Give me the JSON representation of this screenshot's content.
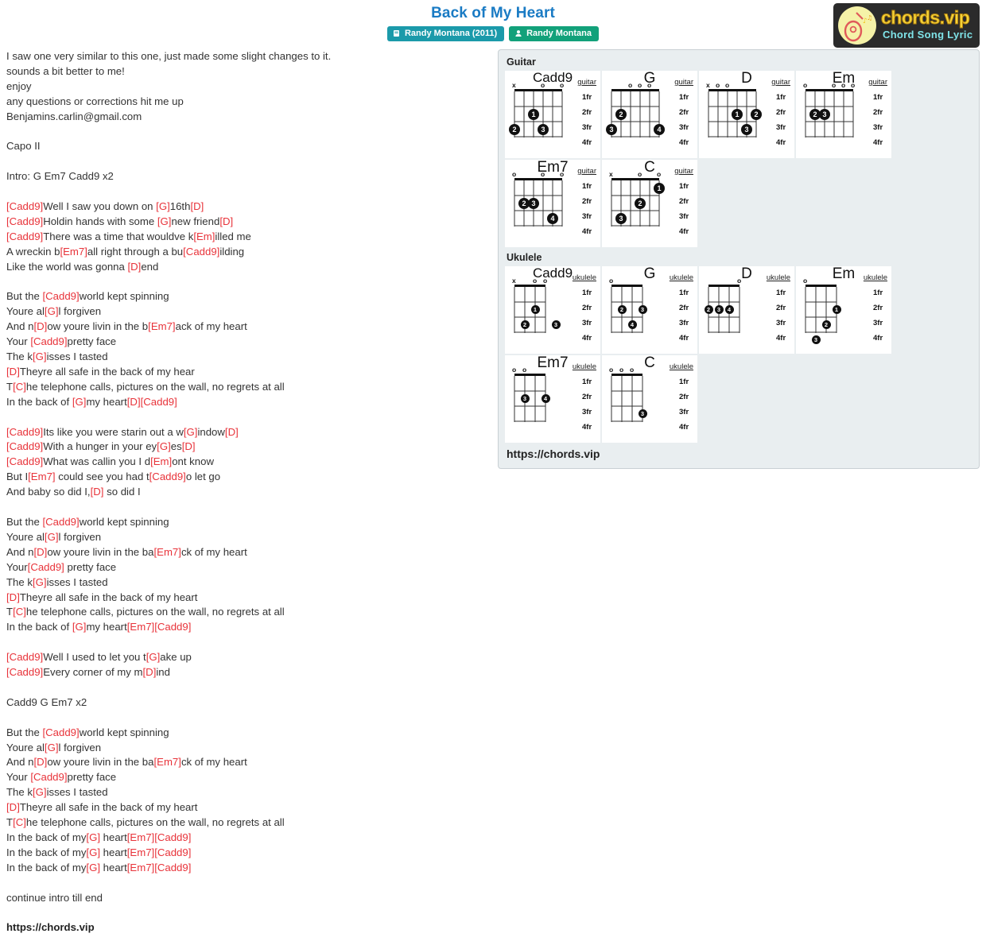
{
  "header": {
    "title": "Back of My Heart",
    "album_badge": "Randy Montana (2011)",
    "artist_badge": "Randy Montana",
    "logo_main": "chords.vip",
    "logo_sub": "Chord Song Lyric"
  },
  "sections": {
    "guitar_label": "Guitar",
    "ukulele_label": "Ukulele",
    "site_url": "https://chords.vip",
    "footer_url": "https://chords.vip"
  },
  "lyrics_lines": [
    {
      "t": "I saw one very similar to this one, just made some slight changes to it."
    },
    {
      "t": "sounds a bit better to me!"
    },
    {
      "t": "enjoy"
    },
    {
      "t": "any questions or corrections hit me up"
    },
    {
      "t": "Benjamins.carlin@gmail.com"
    },
    {
      "t": ""
    },
    {
      "t": "Capo II"
    },
    {
      "t": ""
    },
    {
      "t": "Intro: G Em7 Cadd9 x2"
    },
    {
      "t": ""
    },
    {
      "p": [
        [
          "c",
          "[Cadd9]"
        ],
        [
          "n",
          "Well I saw you down on "
        ],
        [
          "c",
          "[G]"
        ],
        [
          "n",
          "16th"
        ],
        [
          "c",
          "[D]"
        ]
      ]
    },
    {
      "p": [
        [
          "c",
          "[Cadd9]"
        ],
        [
          "n",
          "Holdin hands with some "
        ],
        [
          "c",
          "[G]"
        ],
        [
          "n",
          "new friend"
        ],
        [
          "c",
          "[D]"
        ]
      ]
    },
    {
      "p": [
        [
          "c",
          "[Cadd9]"
        ],
        [
          "n",
          "There was a time that wouldve k"
        ],
        [
          "c",
          "[Em]"
        ],
        [
          "n",
          "illed me"
        ]
      ]
    },
    {
      "p": [
        [
          "n",
          "A wreckin b"
        ],
        [
          "c",
          "[Em7]"
        ],
        [
          "n",
          "all right through a bu"
        ],
        [
          "c",
          "[Cadd9]"
        ],
        [
          "n",
          "ilding"
        ]
      ]
    },
    {
      "p": [
        [
          "n",
          "Like the world was gonna "
        ],
        [
          "c",
          "[D]"
        ],
        [
          "n",
          "end"
        ]
      ]
    },
    {
      "t": ""
    },
    {
      "p": [
        [
          "n",
          "But the "
        ],
        [
          "c",
          "[Cadd9]"
        ],
        [
          "n",
          "world kept spinning"
        ]
      ]
    },
    {
      "p": [
        [
          "n",
          "Youre al"
        ],
        [
          "c",
          "[G]"
        ],
        [
          "n",
          "l forgiven"
        ]
      ]
    },
    {
      "p": [
        [
          "n",
          "And n"
        ],
        [
          "c",
          "[D]"
        ],
        [
          "n",
          "ow youre livin in the b"
        ],
        [
          "c",
          "[Em7]"
        ],
        [
          "n",
          "ack of my heart"
        ]
      ]
    },
    {
      "p": [
        [
          "n",
          "Your "
        ],
        [
          "c",
          "[Cadd9]"
        ],
        [
          "n",
          "pretty face"
        ]
      ]
    },
    {
      "p": [
        [
          "n",
          "The k"
        ],
        [
          "c",
          "[G]"
        ],
        [
          "n",
          "isses I tasted"
        ]
      ]
    },
    {
      "p": [
        [
          "c",
          "[D]"
        ],
        [
          "n",
          "Theyre all safe in the back of my hear"
        ]
      ]
    },
    {
      "p": [
        [
          "n",
          "T"
        ],
        [
          "c",
          "[C]"
        ],
        [
          "n",
          "he telephone calls, pictures on the wall, no regrets at all"
        ]
      ]
    },
    {
      "p": [
        [
          "n",
          "In the back of "
        ],
        [
          "c",
          "[G]"
        ],
        [
          "n",
          "my heart"
        ],
        [
          "c",
          "[D][Cadd9]"
        ]
      ]
    },
    {
      "t": ""
    },
    {
      "p": [
        [
          "c",
          "[Cadd9]"
        ],
        [
          "n",
          "Its like you were starin out a w"
        ],
        [
          "c",
          "[G]"
        ],
        [
          "n",
          "indow"
        ],
        [
          "c",
          "[D]"
        ]
      ]
    },
    {
      "p": [
        [
          "c",
          "[Cadd9]"
        ],
        [
          "n",
          "With a hunger in your ey"
        ],
        [
          "c",
          "[G]"
        ],
        [
          "n",
          "es"
        ],
        [
          "c",
          "[D]"
        ]
      ]
    },
    {
      "p": [
        [
          "c",
          "[Cadd9]"
        ],
        [
          "n",
          "What was callin you I d"
        ],
        [
          "c",
          "[Em]"
        ],
        [
          "n",
          "ont know"
        ]
      ]
    },
    {
      "p": [
        [
          "n",
          "But I"
        ],
        [
          "c",
          "[Em7]"
        ],
        [
          "n",
          " could see you had t"
        ],
        [
          "c",
          "[Cadd9]"
        ],
        [
          "n",
          "o let go"
        ]
      ]
    },
    {
      "p": [
        [
          "n",
          "And baby so did I,"
        ],
        [
          "c",
          "[D]"
        ],
        [
          "n",
          " so did I"
        ]
      ]
    },
    {
      "t": ""
    },
    {
      "p": [
        [
          "n",
          "But the "
        ],
        [
          "c",
          "[Cadd9]"
        ],
        [
          "n",
          "world kept spinning"
        ]
      ]
    },
    {
      "p": [
        [
          "n",
          "Youre al"
        ],
        [
          "c",
          "[G]"
        ],
        [
          "n",
          "l forgiven"
        ]
      ]
    },
    {
      "p": [
        [
          "n",
          "And n"
        ],
        [
          "c",
          "[D]"
        ],
        [
          "n",
          "ow youre livin in the ba"
        ],
        [
          "c",
          "[Em7]"
        ],
        [
          "n",
          "ck of my heart"
        ]
      ]
    },
    {
      "p": [
        [
          "n",
          "Your"
        ],
        [
          "c",
          "[Cadd9]"
        ],
        [
          "n",
          " pretty face"
        ]
      ]
    },
    {
      "p": [
        [
          "n",
          "The k"
        ],
        [
          "c",
          "[G]"
        ],
        [
          "n",
          "isses I tasted"
        ]
      ]
    },
    {
      "p": [
        [
          "c",
          "[D]"
        ],
        [
          "n",
          "Theyre all safe in the back of my heart"
        ]
      ]
    },
    {
      "p": [
        [
          "n",
          "T"
        ],
        [
          "c",
          "[C]"
        ],
        [
          "n",
          "he telephone calls, pictures on the wall, no regrets at all"
        ]
      ]
    },
    {
      "p": [
        [
          "n",
          "In the back of "
        ],
        [
          "c",
          "[G]"
        ],
        [
          "n",
          "my heart"
        ],
        [
          "c",
          "[Em7][Cadd9]"
        ]
      ]
    },
    {
      "t": ""
    },
    {
      "p": [
        [
          "c",
          "[Cadd9]"
        ],
        [
          "n",
          "Well I used to let you t"
        ],
        [
          "c",
          "[G]"
        ],
        [
          "n",
          "ake up"
        ]
      ]
    },
    {
      "p": [
        [
          "c",
          "[Cadd9]"
        ],
        [
          "n",
          "Every corner of my m"
        ],
        [
          "c",
          "[D]"
        ],
        [
          "n",
          "ind"
        ]
      ]
    },
    {
      "t": ""
    },
    {
      "t": "Cadd9 G Em7 x2"
    },
    {
      "t": ""
    },
    {
      "p": [
        [
          "n",
          "But the "
        ],
        [
          "c",
          "[Cadd9]"
        ],
        [
          "n",
          "world kept spinning"
        ]
      ]
    },
    {
      "p": [
        [
          "n",
          "Youre al"
        ],
        [
          "c",
          "[G]"
        ],
        [
          "n",
          "l forgiven"
        ]
      ]
    },
    {
      "p": [
        [
          "n",
          "And n"
        ],
        [
          "c",
          "[D]"
        ],
        [
          "n",
          "ow youre livin in the ba"
        ],
        [
          "c",
          "[Em7]"
        ],
        [
          "n",
          "ck of my heart"
        ]
      ]
    },
    {
      "p": [
        [
          "n",
          "Your "
        ],
        [
          "c",
          "[Cadd9]"
        ],
        [
          "n",
          "pretty face"
        ]
      ]
    },
    {
      "p": [
        [
          "n",
          "The k"
        ],
        [
          "c",
          "[G]"
        ],
        [
          "n",
          "isses I tasted"
        ]
      ]
    },
    {
      "p": [
        [
          "c",
          "[D]"
        ],
        [
          "n",
          "Theyre all safe in the back of my heart"
        ]
      ]
    },
    {
      "p": [
        [
          "n",
          "T"
        ],
        [
          "c",
          "[C]"
        ],
        [
          "n",
          "he telephone calls, pictures on the wall, no regrets at all"
        ]
      ]
    },
    {
      "p": [
        [
          "n",
          "In the back of my"
        ],
        [
          "c",
          "[G]"
        ],
        [
          "n",
          " heart"
        ],
        [
          "c",
          "[Em7][Cadd9]"
        ]
      ]
    },
    {
      "p": [
        [
          "n",
          "In the back of my"
        ],
        [
          "c",
          "[G]"
        ],
        [
          "n",
          " heart"
        ],
        [
          "c",
          "[Em7][Cadd9]"
        ]
      ]
    },
    {
      "p": [
        [
          "n",
          "In the back of my"
        ],
        [
          "c",
          "[G]"
        ],
        [
          "n",
          " heart"
        ],
        [
          "c",
          "[Em7][Cadd9]"
        ]
      ]
    },
    {
      "t": ""
    },
    {
      "t": "continue intro till end"
    },
    {
      "t": ""
    },
    {
      "t": "https://chords.vip",
      "bold": true
    }
  ],
  "fret_labels": [
    "1fr",
    "2fr",
    "3fr",
    "4fr"
  ],
  "guitar_chords": [
    {
      "name": "Cadd9",
      "instrument": "guitar",
      "strings": 6,
      "open_marks": [
        "x",
        "",
        "",
        "o",
        "",
        "o"
      ],
      "dots": [
        {
          "s": 3,
          "f": 2,
          "n": "1"
        },
        {
          "s": 1,
          "f": 3,
          "n": "2"
        },
        {
          "s": 4,
          "f": 3,
          "n": "3"
        }
      ]
    },
    {
      "name": "G",
      "instrument": "guitar",
      "strings": 6,
      "open_marks": [
        "",
        "",
        "o",
        "o",
        "o",
        ""
      ],
      "dots": [
        {
          "s": 1,
          "f": 3,
          "n": "3"
        },
        {
          "s": 2,
          "f": 2,
          "n": "2"
        },
        {
          "s": 6,
          "f": 3,
          "n": "4"
        }
      ]
    },
    {
      "name": "D",
      "instrument": "guitar",
      "strings": 6,
      "open_marks": [
        "x",
        "o",
        "o",
        "",
        "",
        ""
      ],
      "dots": [
        {
          "s": 4,
          "f": 2,
          "n": "1"
        },
        {
          "s": 6,
          "f": 2,
          "n": "2"
        },
        {
          "s": 5,
          "f": 3,
          "n": "3"
        }
      ]
    },
    {
      "name": "Em",
      "instrument": "guitar",
      "strings": 6,
      "open_marks": [
        "o",
        "",
        "",
        "o",
        "o",
        "o"
      ],
      "dots": [
        {
          "s": 2,
          "f": 2,
          "n": "2"
        },
        {
          "s": 3,
          "f": 2,
          "n": "3"
        }
      ]
    },
    {
      "name": "Em7",
      "instrument": "guitar",
      "strings": 6,
      "open_marks": [
        "o",
        "",
        "",
        "o",
        "",
        "o"
      ],
      "dots": [
        {
          "s": 2,
          "f": 2,
          "n": "2"
        },
        {
          "s": 3,
          "f": 2,
          "n": "3"
        },
        {
          "s": 5,
          "f": 3,
          "n": "4"
        }
      ]
    },
    {
      "name": "C",
      "instrument": "guitar",
      "strings": 6,
      "open_marks": [
        "x",
        "",
        "",
        "o",
        "",
        "o"
      ],
      "dots": [
        {
          "s": 6,
          "f": 1,
          "n": "1"
        },
        {
          "s": 4,
          "f": 2,
          "n": "2"
        },
        {
          "s": 2,
          "f": 3,
          "n": "3"
        }
      ]
    }
  ],
  "ukulele_chords": [
    {
      "name": "Cadd9",
      "instrument": "ukulele",
      "strings": 4,
      "open_marks": [
        "x",
        "",
        "o",
        "o"
      ],
      "dots": [
        {
          "s": 3,
          "f": 2,
          "n": "1"
        },
        {
          "s": 2,
          "f": 3,
          "n": "2"
        },
        {
          "s": 5,
          "f": 3,
          "n": "3"
        }
      ]
    },
    {
      "name": "G",
      "instrument": "ukulele",
      "strings": 4,
      "open_marks": [
        "o",
        "",
        "",
        ""
      ],
      "dots": [
        {
          "s": 2,
          "f": 2,
          "n": "2"
        },
        {
          "s": 4,
          "f": 2,
          "n": "3"
        },
        {
          "s": 3,
          "f": 3,
          "n": "4"
        }
      ]
    },
    {
      "name": "D",
      "instrument": "ukulele",
      "strings": 4,
      "open_marks": [
        "",
        "",
        "",
        "o"
      ],
      "dots": [
        {
          "s": 1,
          "f": 2,
          "n": "2"
        },
        {
          "s": 2,
          "f": 2,
          "n": "3"
        },
        {
          "s": 3,
          "f": 2,
          "n": "4"
        }
      ]
    },
    {
      "name": "Em",
      "instrument": "ukulele",
      "strings": 4,
      "open_marks": [
        "o",
        "",
        "",
        ""
      ],
      "dots": [
        {
          "s": 4,
          "f": 2,
          "n": "1"
        },
        {
          "s": 3,
          "f": 3,
          "n": "2"
        },
        {
          "s": 2,
          "f": 4,
          "n": "3"
        }
      ]
    },
    {
      "name": "Em7",
      "instrument": "ukulele",
      "strings": 4,
      "open_marks": [
        "o",
        "o",
        "",
        ""
      ],
      "dots": [
        {
          "s": 2,
          "f": 2,
          "n": "3"
        },
        {
          "s": 4,
          "f": 2,
          "n": "4"
        }
      ]
    },
    {
      "name": "C",
      "instrument": "ukulele",
      "strings": 4,
      "open_marks": [
        "o",
        "o",
        "o",
        ""
      ],
      "dots": [
        {
          "s": 4,
          "f": 3,
          "n": "3"
        }
      ]
    }
  ],
  "colors": {
    "title": "#1a7bc4",
    "chord": "#e8333a",
    "album_badge": "#1b9aaa",
    "artist_badge": "#12a17a",
    "panel_bg": "#e9eef0"
  }
}
